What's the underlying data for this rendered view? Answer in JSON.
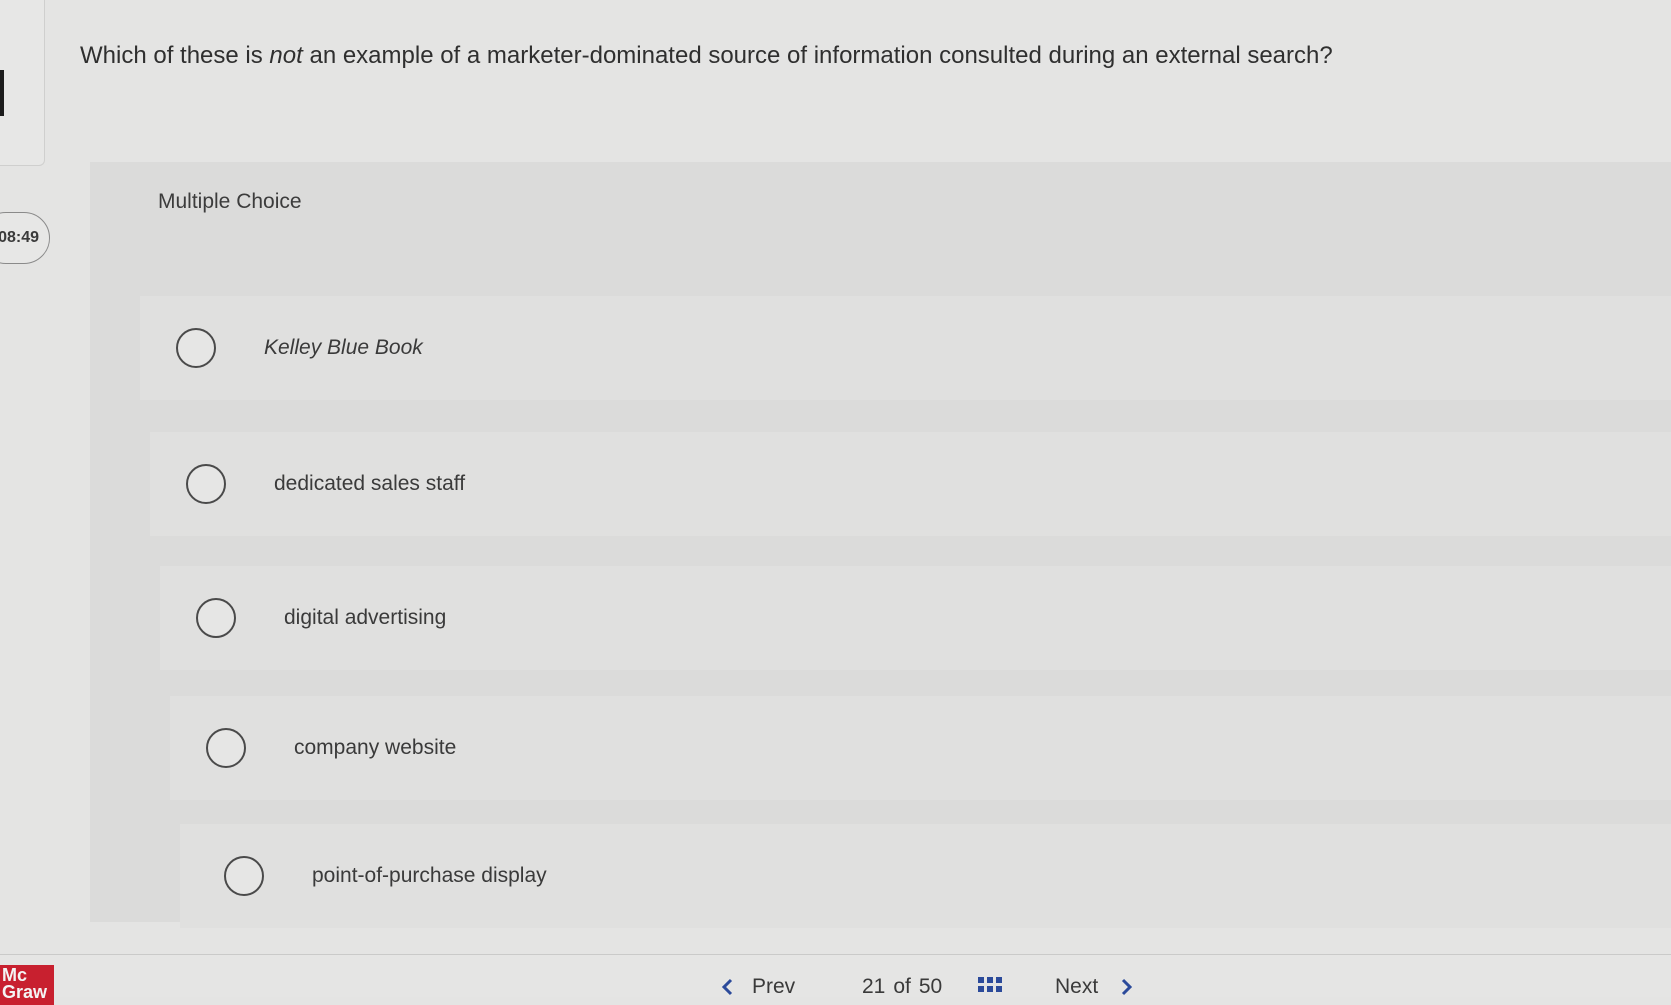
{
  "timer": "08:49",
  "question": {
    "before": "Which of these is ",
    "emphasis": "not",
    "after": " an example of a marketer-dominated source of information consulted during an external search?"
  },
  "choice_type_label": "Multiple Choice",
  "options": [
    {
      "label": "Kelley Blue Book",
      "italic": true
    },
    {
      "label": "dedicated sales staff",
      "italic": false
    },
    {
      "label": "digital advertising",
      "italic": false
    },
    {
      "label": "company website",
      "italic": false
    },
    {
      "label": "point-of-purchase display",
      "italic": false
    }
  ],
  "footer": {
    "logo": "Mc Graw",
    "prev_label": "Prev",
    "prev_icon": "chevron-left-icon",
    "current": "21",
    "of_label": "of",
    "total": "50",
    "grid_icon": "grid-icon",
    "next_label": "Next",
    "next_icon": "chevron-right-icon"
  },
  "colors": {
    "background": "#e4e4e3",
    "panel": "#dbdbda",
    "logo_red": "#c8202f",
    "grid_blue": "#2b4a9a"
  }
}
